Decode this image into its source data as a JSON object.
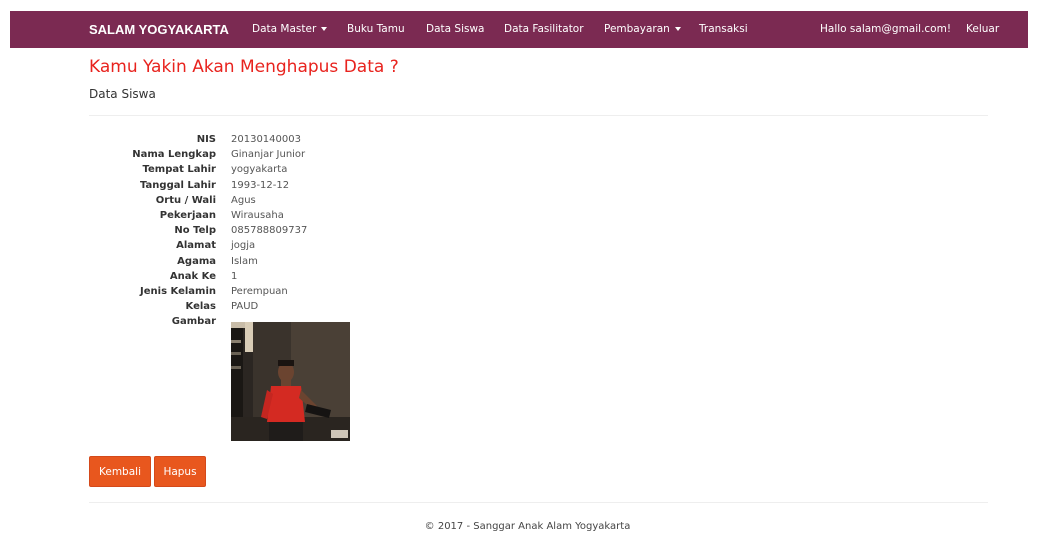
{
  "navbar": {
    "brand": "SALAM YOGYAKARTA",
    "items": [
      {
        "label": "Data Master",
        "dropdown": true
      },
      {
        "label": "Buku Tamu",
        "dropdown": false
      },
      {
        "label": "Data Siswa",
        "dropdown": false
      },
      {
        "label": "Data Fasilitator",
        "dropdown": false
      },
      {
        "label": "Pembayaran",
        "dropdown": true
      },
      {
        "label": "Transaksi",
        "dropdown": false
      }
    ],
    "greeting": "Hallo salam@gmail.com!",
    "logout": "Keluar",
    "color": "#7b2a52"
  },
  "page": {
    "title": "Kamu Yakin Akan Menghapus Data ?",
    "subtitle": "Data Siswa",
    "title_color": "#e8231e"
  },
  "details": [
    {
      "label": "NIS",
      "value": "20130140003"
    },
    {
      "label": "Nama Lengkap",
      "value": "Ginanjar Junior"
    },
    {
      "label": "Tempat Lahir",
      "value": "yogyakarta"
    },
    {
      "label": "Tanggal Lahir",
      "value": "1993-12-12"
    },
    {
      "label": "Ortu / Wali",
      "value": "Agus"
    },
    {
      "label": "Pekerjaan",
      "value": "Wirausaha"
    },
    {
      "label": "No Telp",
      "value": "085788809737"
    },
    {
      "label": "Alamat",
      "value": "jogja"
    },
    {
      "label": "Agama",
      "value": "Islam"
    },
    {
      "label": "Anak Ke",
      "value": "1"
    },
    {
      "label": "Jenis Kelamin",
      "value": "Perempuan"
    },
    {
      "label": "Kelas",
      "value": "PAUD"
    },
    {
      "label": "Gambar",
      "value": ""
    }
  ],
  "buttons": {
    "back": "Kembali",
    "delete": "Hapus",
    "color": "#e8571e"
  },
  "footer": {
    "text": "© 2017 - Sanggar Anak Alam Yogyakarta"
  }
}
